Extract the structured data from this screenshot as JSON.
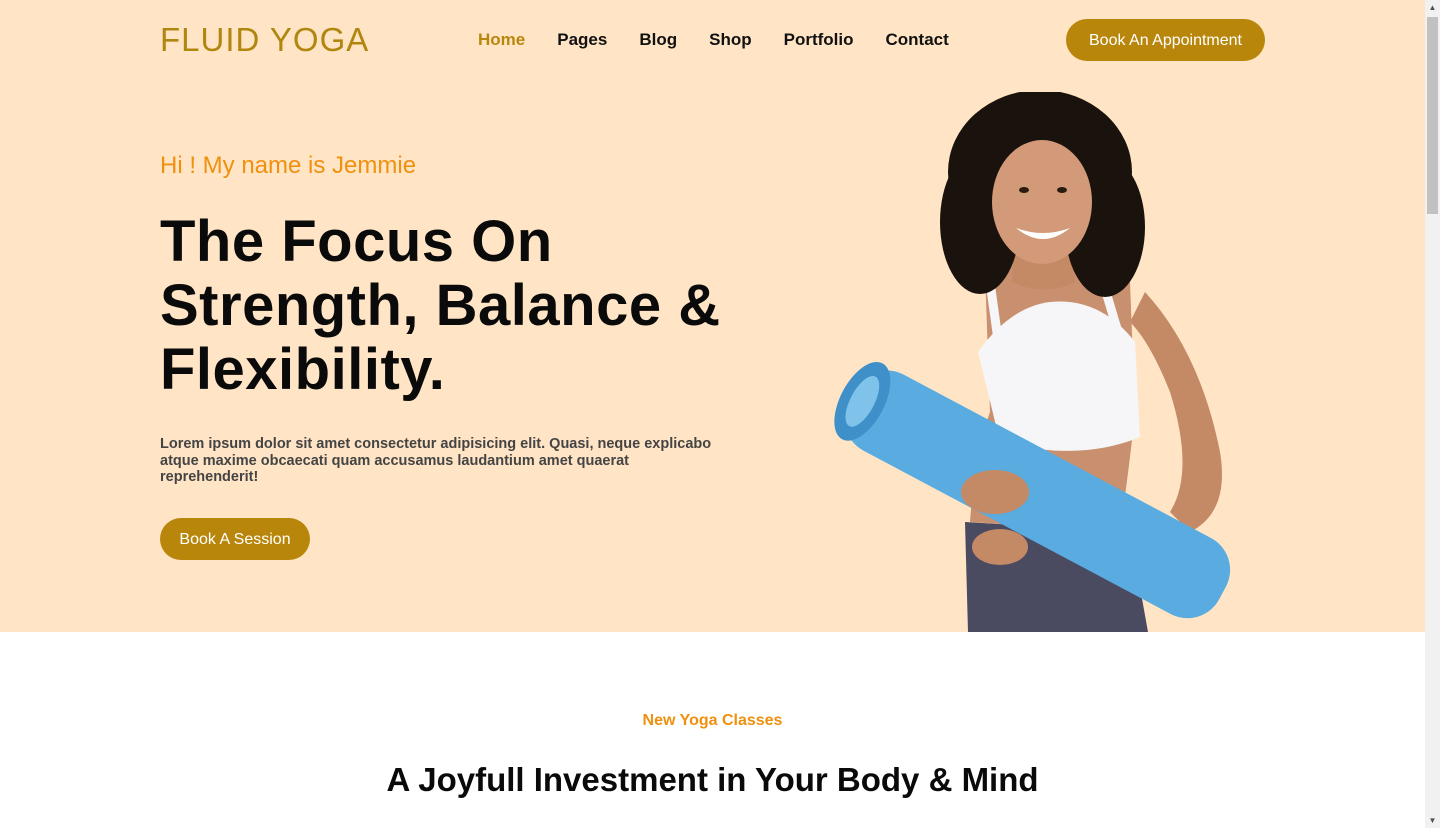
{
  "brand": {
    "logo": "FLUID YOGA"
  },
  "nav": {
    "items": [
      {
        "label": "Home",
        "active": true
      },
      {
        "label": "Pages"
      },
      {
        "label": "Blog"
      },
      {
        "label": "Shop"
      },
      {
        "label": "Portfolio"
      },
      {
        "label": "Contact"
      }
    ],
    "cta_label": "Book An Appointment"
  },
  "hero": {
    "greeting": "Hi ! My name is Jemmie",
    "headline_line1": "The Focus On",
    "headline_line2": "Strength, Balance &",
    "headline_line3": "Flexibility.",
    "lead": "Lorem ipsum dolor sit amet consectetur adipisicing elit. Quasi, neque explicabo atque maxime obcaecati quam accusamus laudantium amet quaerat reprehenderit!",
    "cta_label": "Book A Session",
    "image_icon": "yoga-woman-with-mat-image"
  },
  "classes": {
    "tag": "New Yoga Classes",
    "title": "A Joyfull Investment in Your Body & Mind"
  },
  "colors": {
    "hero_bg": "#ffe5c5",
    "accent": "#b8860b",
    "orange": "#f0900f",
    "mat": "#5aace0"
  }
}
